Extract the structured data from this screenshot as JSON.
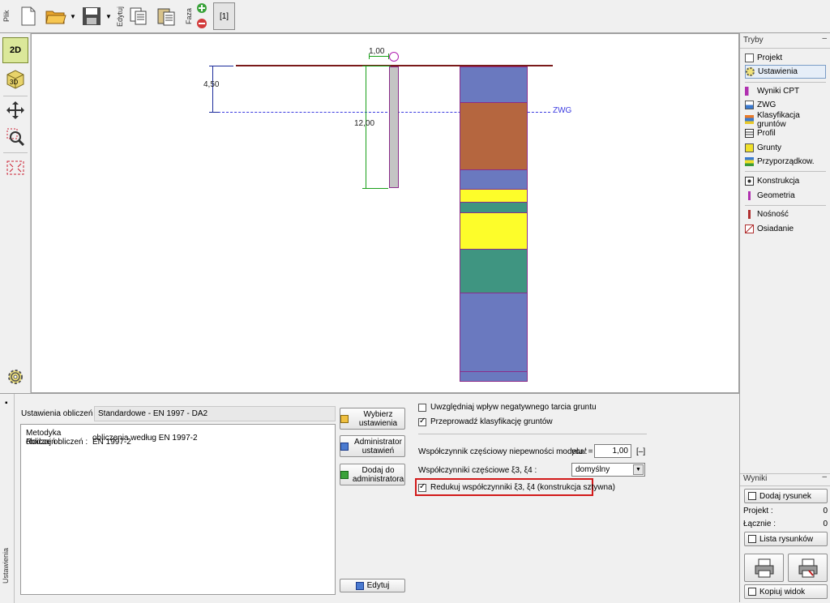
{
  "toolbar": {
    "tab_file": "Plik",
    "tab_edit": "Edytuj",
    "tab_phase": "Faza",
    "phase_label": "[1]"
  },
  "drawing": {
    "dim_top": "1,00",
    "dim_left": "4,50",
    "dim_depth": "12,00",
    "water_label": "ZWG",
    "layer_colors": [
      "#6a79bf",
      "#b5663f",
      "#6a79bf",
      "#fdfd2a",
      "#3f9581",
      "#fdfd2a",
      "#3f9581",
      "#6a79bf",
      "#6a79bf"
    ]
  },
  "modes": {
    "header": "Tryby",
    "items": [
      {
        "label": "Projekt",
        "icon": "document-icon"
      },
      {
        "label": "Ustawienia",
        "icon": "gear-icon"
      },
      {
        "label": "Wyniki CPT",
        "icon": "cpt-results-icon"
      },
      {
        "label": "ZWG",
        "icon": "water-table-icon"
      },
      {
        "label": "Klasyfikacja gruntów",
        "icon": "soil-classification-icon"
      },
      {
        "label": "Profil",
        "icon": "profile-icon"
      },
      {
        "label": "Grunty",
        "icon": "soils-icon"
      },
      {
        "label": "Przyporządkow.",
        "icon": "assign-icon"
      },
      {
        "label": "Konstrukcja",
        "icon": "construction-icon"
      },
      {
        "label": "Geometria",
        "icon": "geometry-icon"
      },
      {
        "label": "Nośność",
        "icon": "bearing-capacity-icon"
      },
      {
        "label": "Osiadanie",
        "icon": "settlement-icon"
      }
    ]
  },
  "results": {
    "header": "Wyniki",
    "add_drawing": "Dodaj rysunek",
    "project_label": "Projekt :",
    "project_value": "0",
    "total_label": "Łącznie :",
    "total_value": "0",
    "drawing_list": "Lista rysunków",
    "copy_view": "Kopiuj widok"
  },
  "settings": {
    "vertical_tab": "Ustawienia",
    "calc_label": "Ustawienia obliczeń :",
    "calc_value": "Standardowe - EN 1997 - DA2",
    "method_label": "Metodyka obliczeń :",
    "method_value": "obliczenia według EN 1997-2",
    "type_label": "Rodzaj obliczeń :",
    "type_value": "EN 1997-2",
    "btn_select": "Wybierz ustawienia",
    "btn_admin": "Administrator ustawień",
    "btn_add_admin": "Dodaj do administratora",
    "btn_edit": "Edytuj",
    "opt_negative_friction": "Uwzględniaj wpływ negatywnego tarcia gruntu",
    "opt_classification": "Przeprowadź klasyfikację gruntów",
    "model_factor_label": "Współczynnik częściowy niepewności modelu :",
    "gamma_label": "γcal =",
    "gamma_value": "1,00",
    "gamma_unit": "[–]",
    "xi_label": "Współczynniki częściowe ξ3, ξ4 :",
    "xi_value": "domyślny",
    "reduce_label": "Redukuj współczynniki ξ3, ξ4 (konstrukcja sztywna)"
  }
}
